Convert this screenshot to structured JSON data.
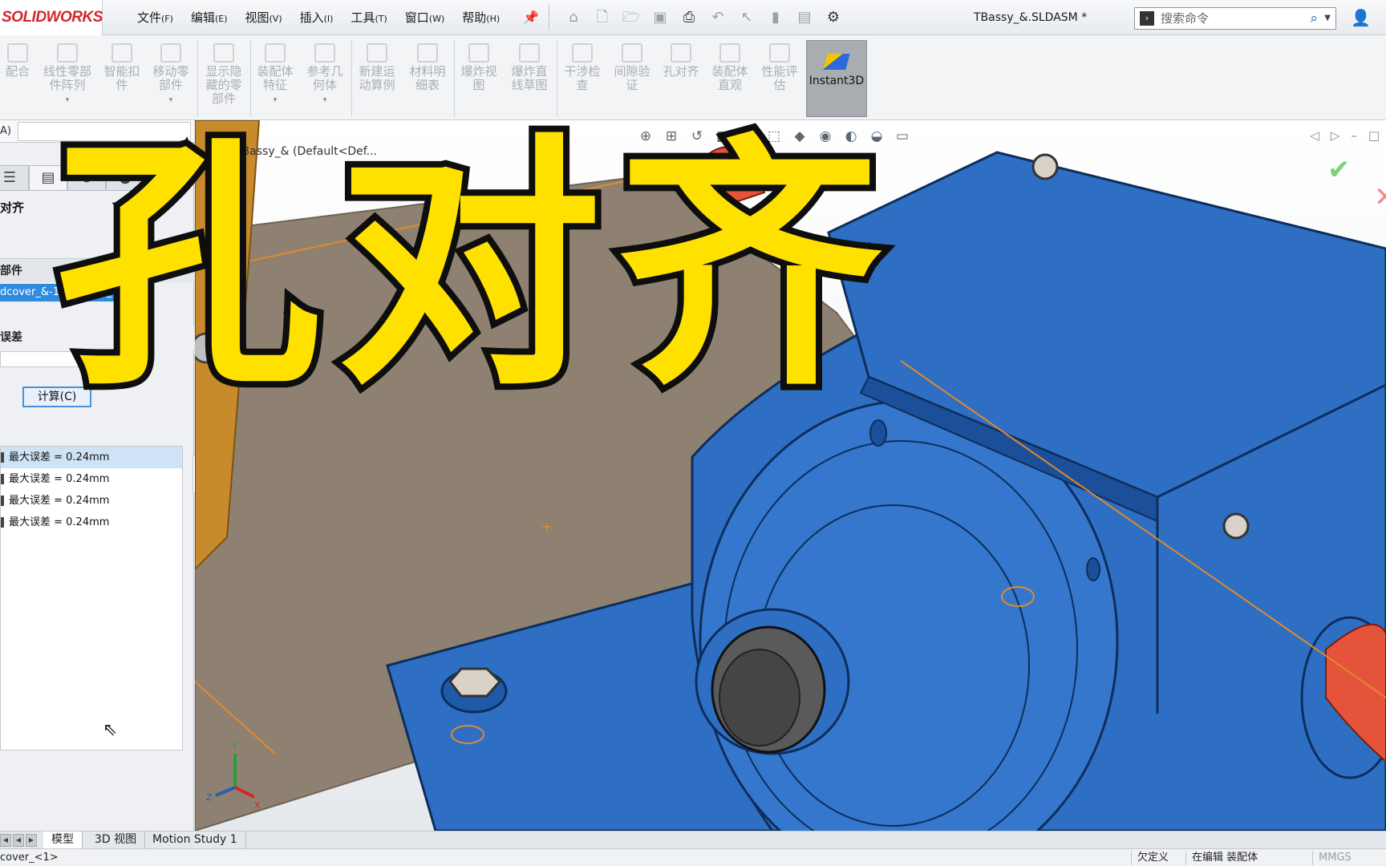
{
  "app": {
    "logo_brand": "SOLIDWORKS",
    "document_title": "TBassy_&.SLDASM *"
  },
  "menu": [
    {
      "label": "文件",
      "accel": "(F)"
    },
    {
      "label": "编辑",
      "accel": "(E)"
    },
    {
      "label": "视图",
      "accel": "(V)"
    },
    {
      "label": "插入",
      "accel": "(I)"
    },
    {
      "label": "工具",
      "accel": "(T)"
    },
    {
      "label": "窗口",
      "accel": "(W)"
    },
    {
      "label": "帮助",
      "accel": "(H)"
    }
  ],
  "search": {
    "placeholder": "搜索命令"
  },
  "ribbon": {
    "buttons": [
      {
        "label": "配合"
      },
      {
        "label": "线性零部件阵列"
      },
      {
        "label": "智能扣件"
      },
      {
        "label": "移动零部件"
      },
      {
        "label": "显示隐藏的零部件"
      },
      {
        "label": "装配体特征"
      },
      {
        "label": "参考几何体"
      },
      {
        "label": "新建运动算例"
      },
      {
        "label": "材料明细表"
      },
      {
        "label": "爆炸视图"
      },
      {
        "label": "爆炸直线草图"
      },
      {
        "label": "干涉检查"
      },
      {
        "label": "间隙验证"
      },
      {
        "label": "孔对齐"
      },
      {
        "label": "装配体直观"
      },
      {
        "label": "性能评估"
      }
    ],
    "instant3d": "Instant3D"
  },
  "property_manager": {
    "filter_label": "A)",
    "title": "对齐",
    "section_components": "部件",
    "selected_component": "dcover_&-1@TBassy_&",
    "section_tolerance": "误差",
    "calculate_button": "计算(C)",
    "results": [
      "最大误差 = 0.24mm",
      "最大误差 = 0.24mm",
      "最大误差 = 0.24mm",
      "最大误差 = 0.24mm"
    ]
  },
  "viewport": {
    "tree_crumb": "TBassy_&  (Default<Def..."
  },
  "overlay_caption": "孔对齐",
  "bottom_tabs": [
    "模型",
    "3D 视图",
    "Motion Study 1"
  ],
  "status": {
    "left": "cover_<1>",
    "definition": "欠定义",
    "mode": "在编辑 装配体",
    "units": "MMGS"
  },
  "colors": {
    "model_blue": "#2e6fc4",
    "plate_tan": "#8f8171",
    "caption_yellow": "#ffe100",
    "selection_blue": "#2f8be0"
  }
}
